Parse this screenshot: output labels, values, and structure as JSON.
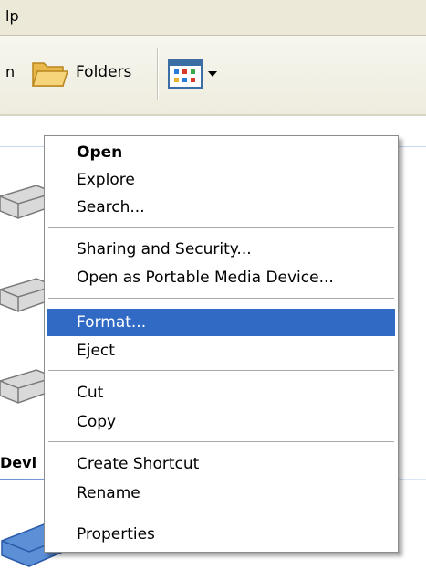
{
  "menubar": {
    "help_partial": "lp"
  },
  "toolbar": {
    "partial_label": "n",
    "folders_label": "Folders",
    "views_icon": "views-icon"
  },
  "content": {
    "section_partial": "Devi"
  },
  "context_menu": {
    "items": [
      {
        "label": "Open",
        "bold": true
      },
      {
        "label": "Explore"
      },
      {
        "label": "Search..."
      },
      {
        "label": "Sharing and Security..."
      },
      {
        "label": "Open as Portable Media Device..."
      },
      {
        "label": "Format...",
        "selected": true
      },
      {
        "label": "Eject"
      },
      {
        "label": "Cut"
      },
      {
        "label": "Copy"
      },
      {
        "label": "Create Shortcut"
      },
      {
        "label": "Rename"
      },
      {
        "label": "Properties"
      }
    ]
  },
  "colors": {
    "selection": "#316ac5",
    "toolbar_bg": "#eeecde"
  }
}
